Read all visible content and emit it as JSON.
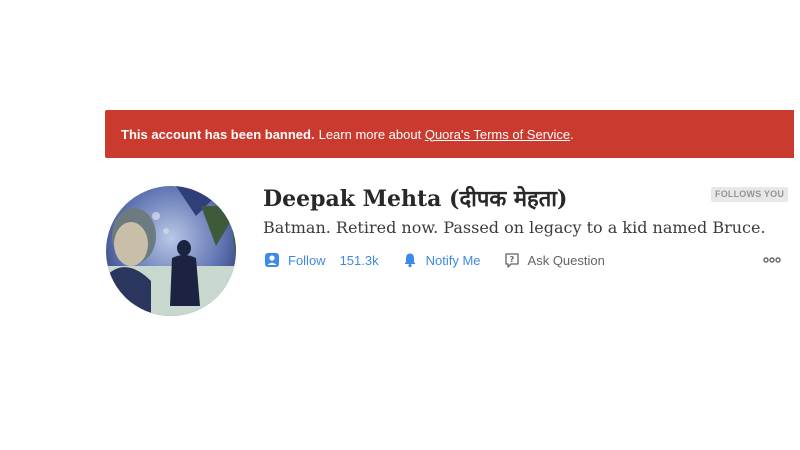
{
  "banner": {
    "strong_text": "This account has been banned.",
    "text": "Learn more about",
    "link_text": "Quora's Terms of Service",
    "suffix": ".",
    "color": "#cb3a2e"
  },
  "profile": {
    "name": "Deepak Mehta (दीपक मेहता)",
    "follows_you_badge": "FOLLOWS YOU",
    "bio": "Batman. Retired now. Passed on legacy to a kid named Bruce."
  },
  "actions": {
    "follow_label": "Follow",
    "follow_count": "151.3k",
    "notify_label": "Notify Me",
    "ask_label": "Ask Question",
    "accent_color": "#3e8ae6"
  },
  "icons": {
    "follow": "follow-user-icon",
    "notify": "bell-icon",
    "ask": "ask-question-icon",
    "more": "more-options-icon"
  }
}
